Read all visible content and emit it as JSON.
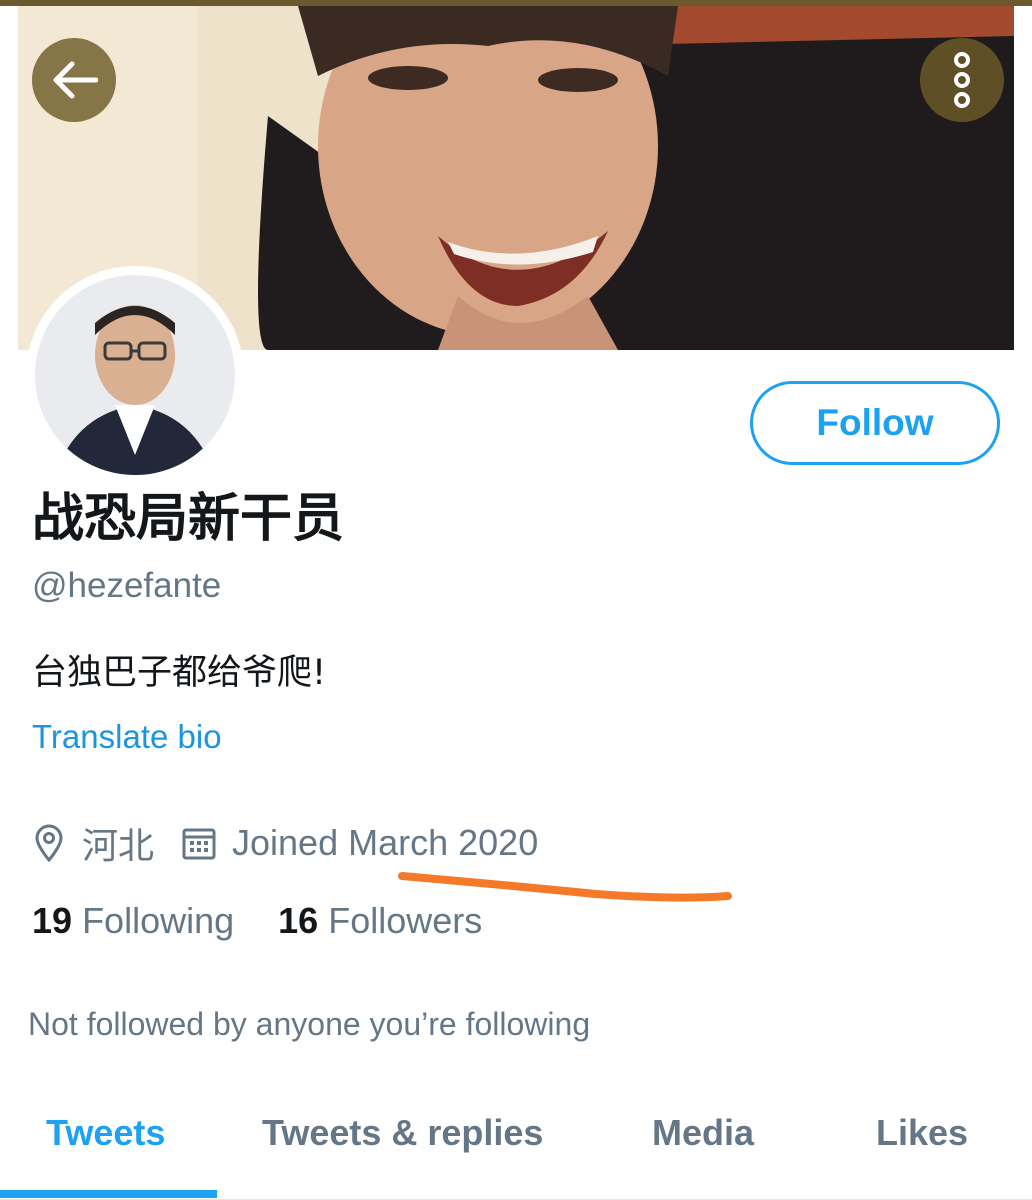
{
  "profile": {
    "display_name": "战恐局新干员",
    "handle": "@hezefante",
    "bio": "台独巴子都给爷爬!",
    "translate_label": "Translate bio",
    "location": "河北",
    "joined": "Joined March 2020",
    "following_count": "19",
    "following_label": "Following",
    "followers_count": "16",
    "followers_label": "Followers",
    "not_followed_text": "Not followed by anyone you’re following"
  },
  "actions": {
    "follow_label": "Follow",
    "back_icon": "arrow-left-icon",
    "more_icon": "more-vertical-icon"
  },
  "tabs": [
    {
      "label": "Tweets",
      "active": true
    },
    {
      "label": "Tweets & replies",
      "active": false
    },
    {
      "label": "Media",
      "active": false
    },
    {
      "label": "Likes",
      "active": false
    }
  ],
  "colors": {
    "accent": "#1da1f2",
    "secondary_text": "#657786",
    "primary_text": "#14171a",
    "annotation_underline": "#f47a2a"
  }
}
